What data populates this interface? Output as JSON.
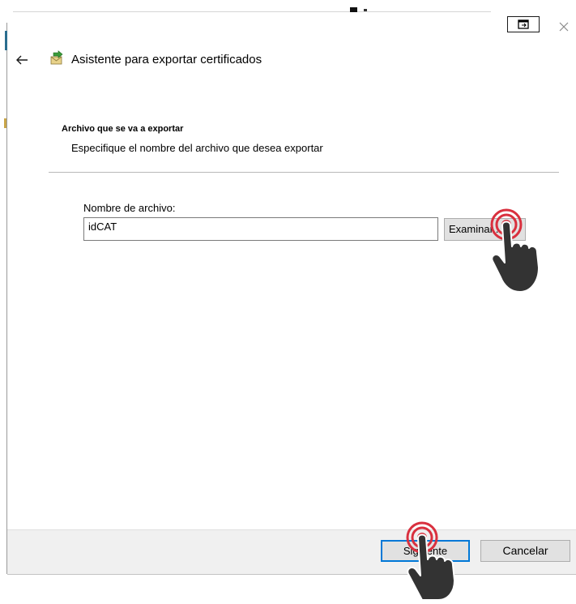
{
  "window": {
    "title": "Asistente para exportar certificados",
    "icons": {
      "back": "back-arrow-icon",
      "wizard": "certificate-wizard-icon",
      "restore": "restore-window-icon",
      "close": "close-icon"
    }
  },
  "section": {
    "heading": "Archivo que se va a exportar",
    "description": "Especifique el nombre del archivo que desea exportar"
  },
  "file": {
    "label": "Nombre de archivo:",
    "value": "idCAT",
    "browse_label": "Examinar..."
  },
  "footer": {
    "next_label": "Siguiente",
    "cancel_label": "Cancelar"
  },
  "overlays": {
    "tap_indicator_color": "#d9303e",
    "hand_color": "#333333"
  },
  "colors": {
    "focus_border": "#0078d7",
    "button_bg": "#e1e1e1",
    "footer_bg": "#f0f0f0"
  }
}
